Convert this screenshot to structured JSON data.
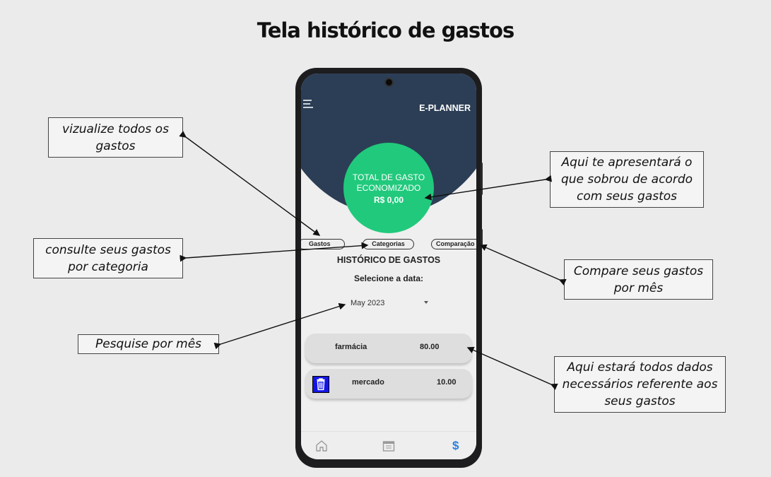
{
  "page_title": "Tela histórico de gastos",
  "app": {
    "title": "E-PLANNER",
    "total": {
      "line1": "TOTAL DE GASTO",
      "line2": "ECONOMIZADO",
      "value": "R$ 0,00"
    },
    "tabs": [
      {
        "label": "Gastos"
      },
      {
        "label": "Categorias"
      },
      {
        "label": "Comparação"
      }
    ],
    "history_title": "HISTÓRICO DE GASTOS",
    "date_label": "Selecione a data:",
    "date_value": "May 2023",
    "expenses": [
      {
        "name": "farmácia",
        "amount": "80.00"
      },
      {
        "name": "mercado",
        "amount": "10.00"
      }
    ],
    "nav_icons": [
      "home-icon",
      "calendar-icon",
      "dollar-icon"
    ],
    "dollar_symbol": "$"
  },
  "callouts": {
    "view_all": "vizualize todos os gastos",
    "by_category": "consulte seus gastos por categoria",
    "by_month": "Pesquise por mês",
    "leftover": "Aqui te apresentará o que sobrou de acordo com seus gastos",
    "compare": "Compare seus gastos por mês",
    "all_data": "Aqui estará todos dados necessários referente aos seus gastos"
  },
  "colors": {
    "header": "#2c3e55",
    "total_circle": "#21c97c",
    "trash_button": "#1316e6",
    "dollar_active": "#2b7fe0"
  }
}
